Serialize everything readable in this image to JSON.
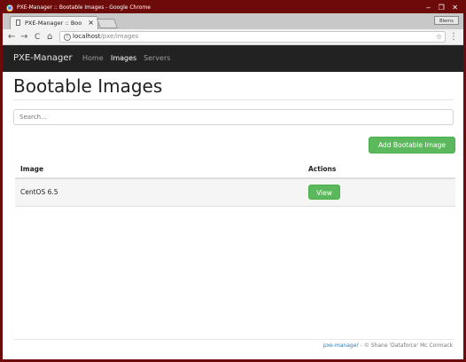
{
  "window": {
    "title": "PXE-Manager :: Bootable Images - Google Chrome",
    "controls": "‒ ❐ ✕",
    "user_chip": "Blerns"
  },
  "tab": {
    "label": "PXE-Manager :: Boo",
    "close": "×"
  },
  "toolbar": {
    "back": "←",
    "forward": "→",
    "reload": "C",
    "home": "⌂",
    "info": "i",
    "url_host": "localhost",
    "url_path": "/pxe/images",
    "star": "☆",
    "menu": "⋮"
  },
  "navbar": {
    "brand": "PXE-Manager",
    "links": [
      {
        "label": "Home",
        "active": false
      },
      {
        "label": "Images",
        "active": true
      },
      {
        "label": "Servers",
        "active": false
      }
    ]
  },
  "main": {
    "title": "Bootable Images",
    "search_placeholder": "Search...",
    "add_button": "Add Bootable Image",
    "table": {
      "columns": [
        "Image",
        "Actions"
      ],
      "rows": [
        {
          "image": "CentOS 6.5",
          "action": "View"
        }
      ]
    }
  },
  "footer": {
    "link": "pxe-manager",
    "text": " - © Shane 'Dataforce' Mc Cormack"
  },
  "colors": {
    "frame": "#6d0b0b",
    "navbar_bg": "#222222",
    "success": "#5cb85c",
    "link": "#337ab7"
  }
}
